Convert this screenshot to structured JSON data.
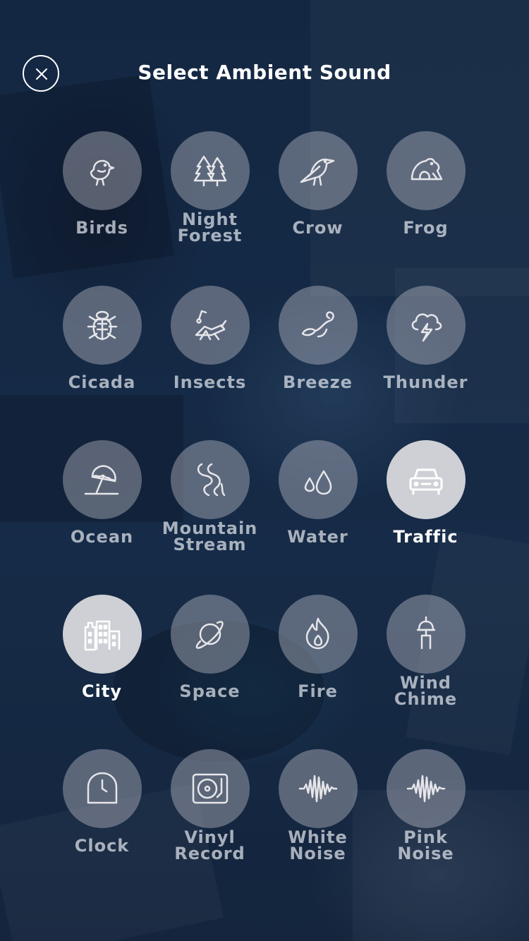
{
  "header": {
    "title": "Select Ambient Sound",
    "close_icon": "close-icon"
  },
  "colors": {
    "icon_stroke": "#e6e6ea",
    "active_icon_stroke": "#ffffff",
    "active_circle": "#dcdce0"
  },
  "sounds": [
    {
      "label": "Birds",
      "icon": "bird-icon",
      "active": false
    },
    {
      "label": "Night\nForest",
      "icon": "trees-icon",
      "active": false
    },
    {
      "label": "Crow",
      "icon": "crow-icon",
      "active": false
    },
    {
      "label": "Frog",
      "icon": "frog-icon",
      "active": false
    },
    {
      "label": "Cicada",
      "icon": "cicada-icon",
      "active": false
    },
    {
      "label": "Insects",
      "icon": "insect-icon",
      "active": false
    },
    {
      "label": "Breeze",
      "icon": "leaf-wind-icon",
      "active": false
    },
    {
      "label": "Thunder",
      "icon": "thunder-cloud-icon",
      "active": false
    },
    {
      "label": "Ocean",
      "icon": "beach-umbrella-icon",
      "active": false
    },
    {
      "label": "Mountain\nStream",
      "icon": "stream-icon",
      "active": false
    },
    {
      "label": "Water",
      "icon": "water-drops-icon",
      "active": false
    },
    {
      "label": "Traffic",
      "icon": "car-icon",
      "active": true
    },
    {
      "label": "City",
      "icon": "buildings-icon",
      "active": true
    },
    {
      "label": "Space",
      "icon": "planet-icon",
      "active": false
    },
    {
      "label": "Fire",
      "icon": "flame-icon",
      "active": false
    },
    {
      "label": "Wind\nChime",
      "icon": "wind-chime-icon",
      "active": false
    },
    {
      "label": "Clock",
      "icon": "clock-icon",
      "active": false
    },
    {
      "label": "Vinyl\nRecord",
      "icon": "turntable-icon",
      "active": false
    },
    {
      "label": "White\nNoise",
      "icon": "waveform-icon",
      "active": false
    },
    {
      "label": "Pink\nNoise",
      "icon": "waveform-icon",
      "active": false
    }
  ]
}
